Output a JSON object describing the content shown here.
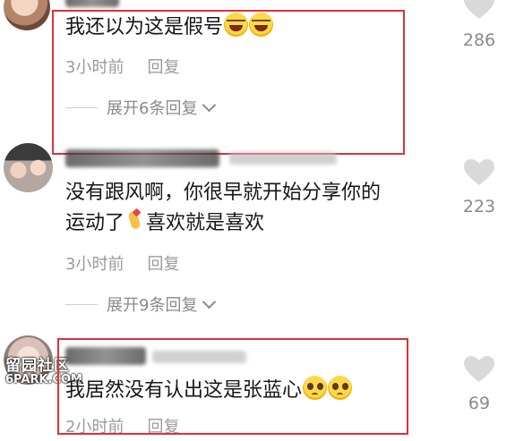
{
  "comments": [
    {
      "text": "我还以为这是假号",
      "emoji": [
        "laugh-cry-emoji",
        "laugh-cry-emoji"
      ],
      "time": "3小时前",
      "reply_label": "回复",
      "expand_label": "展开6条回复",
      "likes": "286"
    },
    {
      "text_line1": "没有跟风啊，你很早就开始分享你的",
      "text_line2_a": "运动了",
      "text_line2_b": "喜欢就是喜欢",
      "emoji": [
        "finger-heart-emoji"
      ],
      "time": "3小时前",
      "reply_label": "回复",
      "expand_label": "展开9条回复",
      "likes": "223"
    },
    {
      "text": "我居然没有认出这是张蓝心",
      "emoji": [
        "pleading-face-emoji",
        "pleading-face-emoji"
      ],
      "time": "2小时前",
      "reply_label": "回复",
      "likes": "69"
    }
  ],
  "watermark": {
    "line1": "留园社区",
    "line2": "6PARK.COM"
  },
  "colors": {
    "highlight": "#e0303b",
    "meta_text": "#9a9a9a",
    "heart": "#d9d9d9"
  }
}
